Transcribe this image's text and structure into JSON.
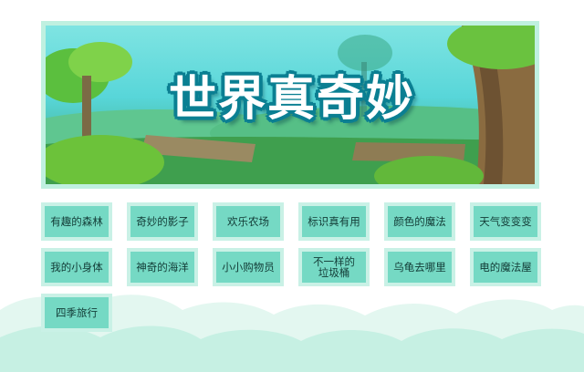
{
  "banner": {
    "title": "世界真奇妙"
  },
  "nav": {
    "items": [
      {
        "label": "有趣的森林"
      },
      {
        "label": "奇妙的影子"
      },
      {
        "label": "欢乐农场"
      },
      {
        "label": "标识真有用"
      },
      {
        "label": "颜色的魔法"
      },
      {
        "label": "天气变变变"
      },
      {
        "label": "我的小身体"
      },
      {
        "label": "神奇的海洋"
      },
      {
        "label": "小小购物员"
      },
      {
        "label": "不一样的\n垃圾桶"
      },
      {
        "label": "乌龟去哪里"
      },
      {
        "label": "电的魔法屋"
      },
      {
        "label": "四季旅行"
      }
    ]
  },
  "colors": {
    "button_fill": "#75d9c4",
    "button_border": "#c9f1e6",
    "cloud": "#c6f0e3"
  }
}
